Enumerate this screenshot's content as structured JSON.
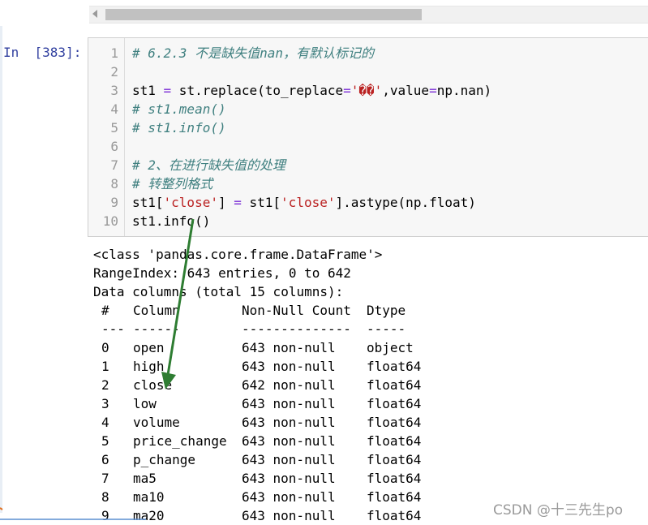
{
  "prompt": "In  [383]:",
  "code": [
    {
      "n": "1",
      "parts": [
        {
          "t": "# 6.2.3 不是缺失值nan，有默认标记的",
          "c": "cm"
        }
      ]
    },
    {
      "n": "2",
      "parts": []
    },
    {
      "n": "3",
      "parts": [
        {
          "t": "st1 ",
          "c": ""
        },
        {
          "t": "=",
          "c": "op"
        },
        {
          "t": " st.replace(to_replace",
          "c": ""
        },
        {
          "t": "=",
          "c": "op"
        },
        {
          "t": "'��'",
          "c": "str"
        },
        {
          "t": ",value",
          "c": ""
        },
        {
          "t": "=",
          "c": "op"
        },
        {
          "t": "np.nan)",
          "c": ""
        }
      ]
    },
    {
      "n": "4",
      "parts": [
        {
          "t": "# st1.mean()",
          "c": "cm"
        }
      ]
    },
    {
      "n": "5",
      "parts": [
        {
          "t": "# st1.info()",
          "c": "cm"
        }
      ]
    },
    {
      "n": "6",
      "parts": []
    },
    {
      "n": "7",
      "parts": [
        {
          "t": "# 2、在进行缺失值的处理",
          "c": "cm"
        }
      ]
    },
    {
      "n": "8",
      "parts": [
        {
          "t": "# 转整列格式",
          "c": "cm"
        }
      ]
    },
    {
      "n": "9",
      "parts": [
        {
          "t": "st1[",
          "c": ""
        },
        {
          "t": "'close'",
          "c": "str"
        },
        {
          "t": "] ",
          "c": ""
        },
        {
          "t": "=",
          "c": "op"
        },
        {
          "t": " st1[",
          "c": ""
        },
        {
          "t": "'close'",
          "c": "str"
        },
        {
          "t": "].astype(np.float)",
          "c": ""
        }
      ]
    },
    {
      "n": "10",
      "parts": [
        {
          "t": "st1.info()",
          "c": ""
        }
      ]
    }
  ],
  "output": {
    "header_lines": [
      "<class 'pandas.core.frame.DataFrame'>",
      "RangeIndex: 643 entries, 0 to 642",
      "Data columns (total 15 columns):"
    ],
    "table_header": [
      "#",
      "Column",
      "Non-Null Count",
      "Dtype"
    ],
    "table_sep": [
      "---",
      "------",
      "--------------",
      "-----"
    ],
    "rows": [
      [
        "0",
        "open",
        "643 non-null",
        "object"
      ],
      [
        "1",
        "high",
        "643 non-null",
        "float64"
      ],
      [
        "2",
        "close",
        "642 non-null",
        "float64"
      ],
      [
        "3",
        "low",
        "643 non-null",
        "float64"
      ],
      [
        "4",
        "volume",
        "643 non-null",
        "float64"
      ],
      [
        "5",
        "price_change",
        "643 non-null",
        "float64"
      ],
      [
        "6",
        "p_change",
        "643 non-null",
        "float64"
      ],
      [
        "7",
        "ma5",
        "643 non-null",
        "float64"
      ],
      [
        "8",
        "ma10",
        "643 non-null",
        "float64"
      ],
      [
        "9",
        "ma20",
        "643 non-null",
        "float64"
      ]
    ]
  },
  "watermark": "CSDN @十三先生po",
  "colors": {
    "comment": "#408080",
    "string": "#ba2121",
    "operator": "#7a2bd6",
    "prompt": "#303f9f",
    "arrow": "#2e7d32"
  }
}
